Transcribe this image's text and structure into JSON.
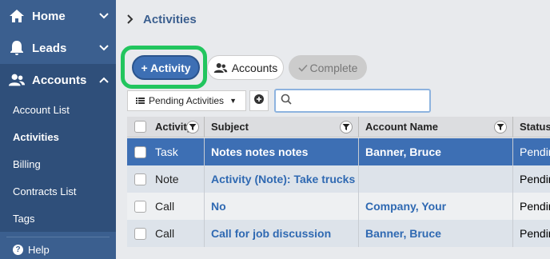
{
  "sidebar": {
    "nav": [
      {
        "label": "Home",
        "icon": "home-icon"
      },
      {
        "label": "Leads",
        "icon": "bell-icon"
      },
      {
        "label": "Accounts",
        "icon": "users-icon"
      }
    ],
    "submenu": [
      "Account List",
      "Activities",
      "Billing",
      "Contracts List",
      "Tags"
    ],
    "active_item": "Activities",
    "help": "Help"
  },
  "breadcrumb": {
    "current": "Activities"
  },
  "toolbar": {
    "add_activity": "+ Activity",
    "accounts": "Accounts",
    "complete": "Complete"
  },
  "filter": {
    "selected": "Pending Activities",
    "search_placeholder": ""
  },
  "table": {
    "columns": [
      "Activity",
      "Subject",
      "Account Name",
      "Status"
    ],
    "rows": [
      {
        "type": "Task",
        "subject": "Notes notes notes",
        "account": "Banner, Bruce",
        "status": "Pending"
      },
      {
        "type": "Note",
        "subject": "Activity (Note): Take trucks",
        "account": "",
        "status": "Pending"
      },
      {
        "type": "Call",
        "subject": "No",
        "account": "Company, Your",
        "status": "Pending"
      },
      {
        "type": "Call",
        "subject": "Call for job discussion",
        "account": "Banner, Bruce",
        "status": "Pending"
      }
    ]
  },
  "colors": {
    "sidebar": "#3b5f8f",
    "accent": "#3d6fb4",
    "highlight": "#22c55e"
  }
}
